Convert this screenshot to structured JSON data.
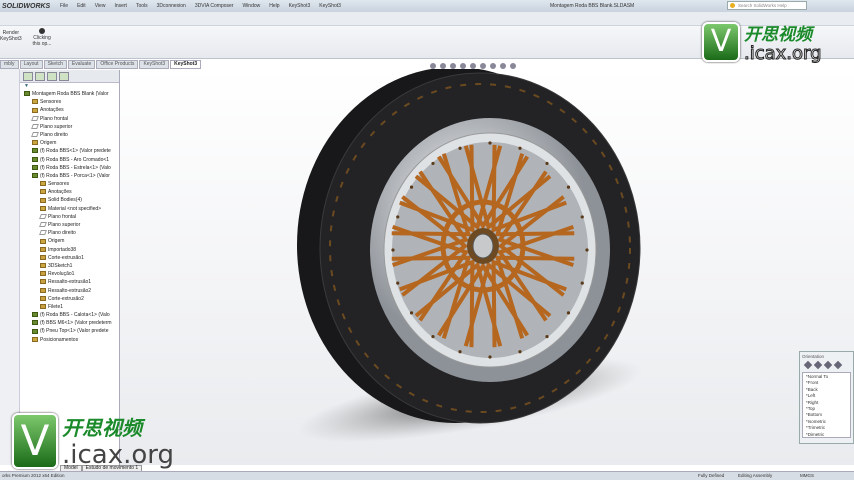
{
  "app": {
    "logo": "SOLIDWORKS",
    "title": "Montagem Roda BBS Blank.SLDASM",
    "search_placeholder": "Search SolidWorks Help"
  },
  "menu": [
    "File",
    "Edit",
    "View",
    "Insert",
    "Tools",
    "3Dconnexion",
    "3DVIA Composer",
    "Window",
    "Help",
    "KeyShot3",
    "KeyShot3"
  ],
  "ribbon": {
    "render": "Render",
    "keyshot": "KeyShot3",
    "clicking": "Clicking this op..."
  },
  "tabs": [
    "mbly",
    "Layout",
    "Sketch",
    "Evaluate",
    "Office Products",
    "KeyShot3",
    "KeyShot3"
  ],
  "tree": {
    "items": [
      {
        "label": "Montagem Roda BBS Blank  (Valor",
        "icon": "asm",
        "indent": 0
      },
      {
        "label": "Sensores",
        "icon": "folder",
        "indent": 1
      },
      {
        "label": "Anotações",
        "icon": "annot",
        "indent": 1
      },
      {
        "label": "Plano frontal",
        "icon": "plane",
        "indent": 1
      },
      {
        "label": "Plano superior",
        "icon": "plane",
        "indent": 1
      },
      {
        "label": "Plano direito",
        "icon": "plane",
        "indent": 1
      },
      {
        "label": "Origem",
        "icon": "origin",
        "indent": 1
      },
      {
        "label": "(f) Roda BBS<1> (Valor predete",
        "icon": "asm",
        "indent": 1
      },
      {
        "label": "(f) Roda BBS - Aro Cromado<1",
        "icon": "asm",
        "indent": 1
      },
      {
        "label": "(f) Roda BBS - Estrela<1> (Valo",
        "icon": "asm",
        "indent": 1
      },
      {
        "label": "(f) Roda BBS - Porca<1> (Valor",
        "icon": "asm",
        "indent": 1
      },
      {
        "label": "Sensores",
        "icon": "folder",
        "indent": 2
      },
      {
        "label": "Anotações",
        "icon": "annot",
        "indent": 2
      },
      {
        "label": "Solid Bodies(4)",
        "icon": "feat",
        "indent": 2
      },
      {
        "label": "Material <not specified>",
        "icon": "material",
        "indent": 2
      },
      {
        "label": "Plano frontal",
        "icon": "plane",
        "indent": 2
      },
      {
        "label": "Plano superior",
        "icon": "plane",
        "indent": 2
      },
      {
        "label": "Plano direito",
        "icon": "plane",
        "indent": 2
      },
      {
        "label": "Origem",
        "icon": "origin",
        "indent": 2
      },
      {
        "label": "Importado38",
        "icon": "feat",
        "indent": 2
      },
      {
        "label": "Corte-extrusão1",
        "icon": "feat",
        "indent": 2
      },
      {
        "label": "3DSketch1",
        "icon": "sketch",
        "indent": 2
      },
      {
        "label": "Revolução1",
        "icon": "feat",
        "indent": 2
      },
      {
        "label": "Ressalto-extrusão1",
        "icon": "feat",
        "indent": 2
      },
      {
        "label": "Ressalto-extrusão2",
        "icon": "feat",
        "indent": 2
      },
      {
        "label": "Corte-extrusão2",
        "icon": "feat",
        "indent": 2
      },
      {
        "label": "Filete1",
        "icon": "feat",
        "indent": 2
      },
      {
        "label": "(f) Roda BBS - Calota<1> (Valo",
        "icon": "asm",
        "indent": 1
      },
      {
        "label": "(f) BBS M6<1> (Valor predeterm",
        "icon": "asm",
        "indent": 1
      },
      {
        "label": "(f) Pneu Top<1> (Valor predete",
        "icon": "asm",
        "indent": 1
      },
      {
        "label": "Posicionamentos",
        "icon": "mates",
        "indent": 1
      }
    ]
  },
  "orientation": {
    "title": "Orientation",
    "items": [
      "*Normal To",
      "*Front",
      "*Back",
      "*Left",
      "*Right",
      "*Top",
      "*Bottom",
      "*Isometric",
      "*Trimetric",
      "*Dimetric"
    ]
  },
  "bottom_tabs": [
    "Model",
    "Estudo de movimento 1"
  ],
  "status": {
    "edition": "orks Premium 2012 x64 Edition",
    "defined": "Fully Defined",
    "mode": "Editing Assembly",
    "units": "MMGS"
  },
  "watermark": {
    "v": "V",
    "cn": "开思视频",
    "org": ".icax.org"
  },
  "colors": {
    "spokes": "#b5661f",
    "tire": "#1c1c1e",
    "rim": "#c8ccd0"
  }
}
